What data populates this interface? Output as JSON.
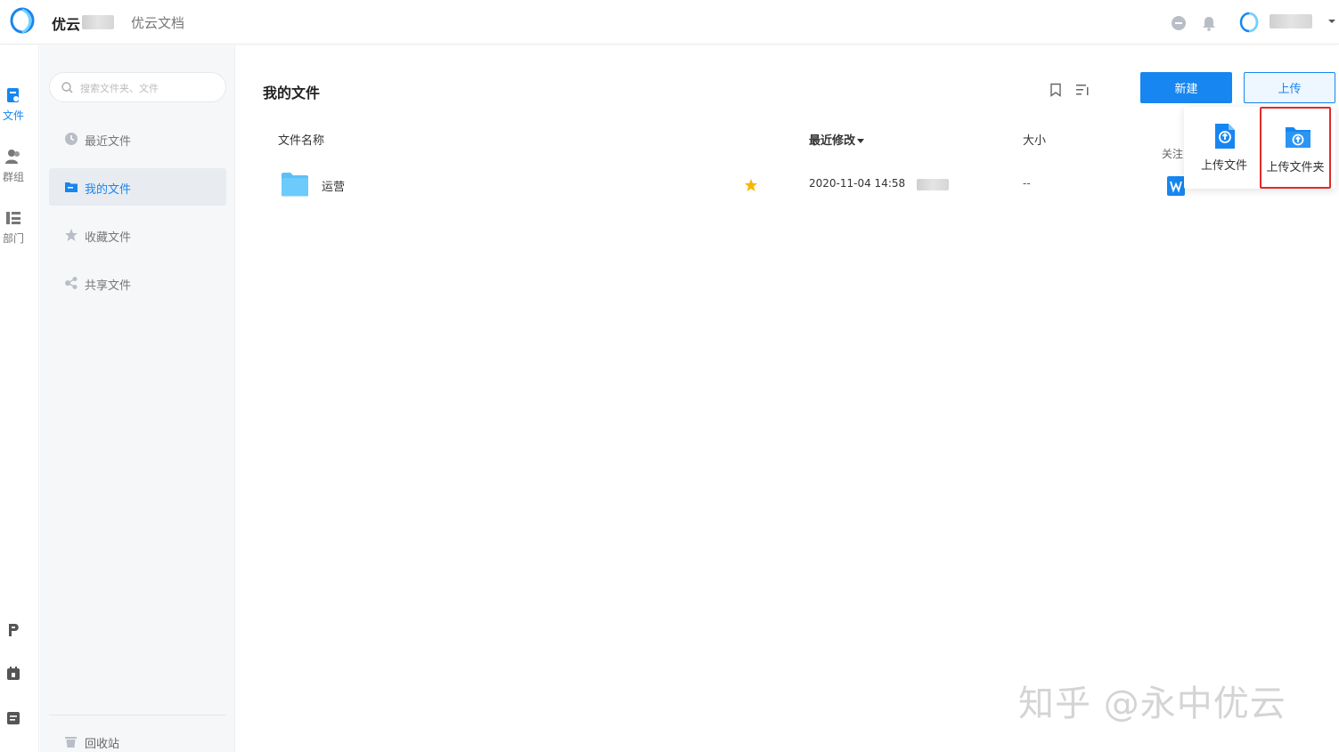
{
  "header": {
    "org_name": "优云",
    "app_name": "优云文档",
    "icons": [
      "chat-icon",
      "bell-icon",
      "avatar-logo-icon",
      "chevron-down-icon"
    ]
  },
  "rail": {
    "items": [
      {
        "label": "文件",
        "icon": "file-icon",
        "active": true
      },
      {
        "label": "群组",
        "icon": "group-icon"
      },
      {
        "label": "部门",
        "icon": "department-icon"
      }
    ],
    "bottom_icons": [
      "p-icon",
      "calendar-icon",
      "note-icon"
    ]
  },
  "sidebar": {
    "search_placeholder": "搜索文件夹、文件",
    "items": [
      {
        "label": "最近文件",
        "icon": "clock-icon"
      },
      {
        "label": "我的文件",
        "icon": "folder-icon",
        "active": true
      },
      {
        "label": "收藏文件",
        "icon": "star-icon"
      },
      {
        "label": "共享文件",
        "icon": "share-icon"
      }
    ],
    "recycle_label": "回收站"
  },
  "main": {
    "title": "我的文件",
    "new_button": "新建",
    "upload_button": "上传",
    "columns": {
      "name": "文件名称",
      "modified": "最近修改",
      "size": "大小",
      "follow": "关注"
    },
    "rows": [
      {
        "name": "运营",
        "starred": true,
        "modified": "2020-11-04 14:58",
        "size": "--"
      }
    ]
  },
  "upload_menu": {
    "items": [
      {
        "label": "上传文件",
        "icon": "upload-file-icon"
      },
      {
        "label": "上传文件夹",
        "icon": "upload-folder-icon",
        "highlighted": true
      }
    ]
  },
  "watermark": "知乎 @永中优云",
  "colors": {
    "accent": "#1786f0",
    "highlight_border": "#e02b2b",
    "folder": "#5bc0f8",
    "star": "#f5b800"
  }
}
